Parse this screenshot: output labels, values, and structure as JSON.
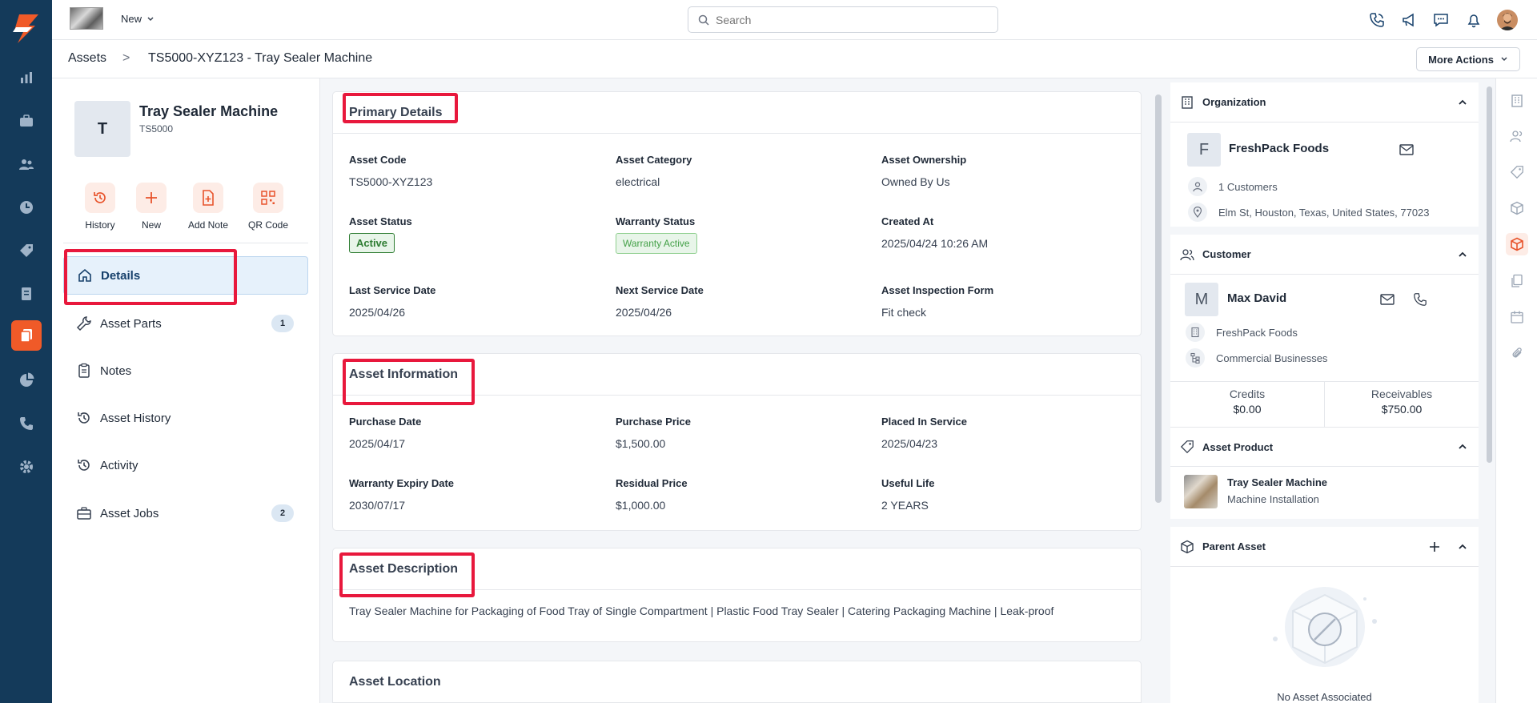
{
  "topbar": {
    "new_label": "New",
    "search_placeholder": "Search"
  },
  "breadcrumb": {
    "root": "Assets",
    "separator": ">",
    "current": "TS5000-XYZ123 - Tray Sealer Machine",
    "more_actions": "More Actions"
  },
  "asset": {
    "initial": "T",
    "name": "Tray Sealer Machine",
    "model": "TS5000"
  },
  "quick_actions": [
    "History",
    "New",
    "Add Note",
    "QR Code"
  ],
  "nav": [
    {
      "label": "Details"
    },
    {
      "label": "Asset Parts",
      "badge": "1"
    },
    {
      "label": "Notes"
    },
    {
      "label": "Asset History"
    },
    {
      "label": "Activity"
    },
    {
      "label": "Asset Jobs",
      "badge": "2"
    }
  ],
  "primary_details": {
    "title": "Primary Details",
    "asset_code_label": "Asset Code",
    "asset_code": "TS5000-XYZ123",
    "asset_category_label": "Asset Category",
    "asset_category": "electrical",
    "asset_ownership_label": "Asset Ownership",
    "asset_ownership": "Owned By Us",
    "asset_status_label": "Asset Status",
    "asset_status": "Active",
    "warranty_status_label": "Warranty Status",
    "warranty_status": "Warranty Active",
    "created_at_label": "Created At",
    "created_at": "2025/04/24 10:26 AM",
    "last_service_label": "Last Service Date",
    "last_service": "2025/04/26",
    "next_service_label": "Next Service Date",
    "next_service": "2025/04/26",
    "inspection_form_label": "Asset Inspection Form",
    "inspection_form": "Fit check"
  },
  "asset_information": {
    "title": "Asset Information",
    "purchase_date_label": "Purchase Date",
    "purchase_date": "2025/04/17",
    "purchase_price_label": "Purchase Price",
    "purchase_price": "$1,500.00",
    "placed_in_service_label": "Placed In Service",
    "placed_in_service": "2025/04/23",
    "warranty_expiry_label": "Warranty Expiry Date",
    "warranty_expiry": "2030/07/17",
    "residual_price_label": "Residual Price",
    "residual_price": "$1,000.00",
    "useful_life_label": "Useful Life",
    "useful_life": "2 YEARS"
  },
  "asset_description": {
    "title": "Asset Description",
    "text": "Tray Sealer Machine for Packaging of Food Tray of Single Compartment | Plastic Food Tray Sealer | Catering Packaging Machine | Leak-proof"
  },
  "asset_location": {
    "title": "Asset Location"
  },
  "organization": {
    "title": "Organization",
    "initial": "F",
    "name": "FreshPack Foods",
    "customers": "1 Customers",
    "address": "Elm St, Houston, Texas, United States, 77023"
  },
  "customer": {
    "title": "Customer",
    "initial": "M",
    "name": "Max David",
    "company": "FreshPack Foods",
    "segment": "Commercial Businesses",
    "credits_label": "Credits",
    "credits": "$0.00",
    "receivables_label": "Receivables",
    "receivables": "$750.00"
  },
  "asset_product": {
    "title": "Asset Product",
    "name": "Tray Sealer Machine",
    "category": "Machine Installation"
  },
  "parent_asset": {
    "title": "Parent Asset",
    "empty_text": "No Asset Associated"
  },
  "colors": {
    "navy": "#143a5a",
    "accent": "#f05a28",
    "highlight": "#e8183c",
    "active_green": "#2e7d32"
  }
}
